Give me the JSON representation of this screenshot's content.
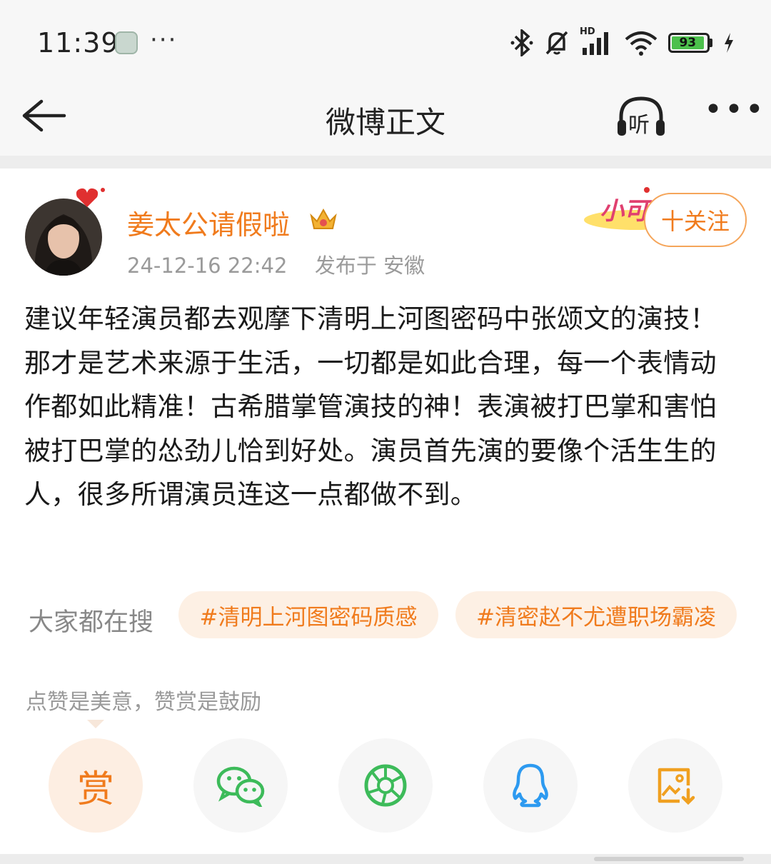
{
  "status_bar": {
    "time": "11:39",
    "more": "···",
    "network": "HD",
    "battery": "93",
    "colors": {
      "battery_fill": "#4cc04c"
    }
  },
  "nav": {
    "title": "微博正文",
    "listen_label": "听",
    "more": "•••"
  },
  "post": {
    "author": "姜太公请假啦",
    "timestamp": "24-12-16 22:42",
    "location": "发布于 安徽",
    "follow_label": "十关注",
    "follow_deco_text": "小可",
    "content": "建议年轻演员都去观摩下清明上河图密码中张颂文的演技！那才是艺术来源于生活，一切都是如此合理，每一个表情动作都如此精准！古希腊掌管演技的神！表演被打巴掌和害怕被打巴掌的怂劲儿恰到好处。演员首先演的要像个活生生的人，很多所谓演员连这一点都做不到。"
  },
  "search": {
    "label": "大家都在搜",
    "tags": [
      "#清明上河图密码质感",
      "#清密赵不尤遭职场霸凌"
    ]
  },
  "reward": {
    "hint": "点赞是美意，赞赏是鼓励",
    "button_label": "赏"
  },
  "share_icons": [
    "wechat-icon",
    "moments-icon",
    "qq-icon",
    "save-image-icon"
  ],
  "colors": {
    "accent": "#f07b1d",
    "tag_bg": "#fdf0e4",
    "meta": "#9a9a9a"
  }
}
